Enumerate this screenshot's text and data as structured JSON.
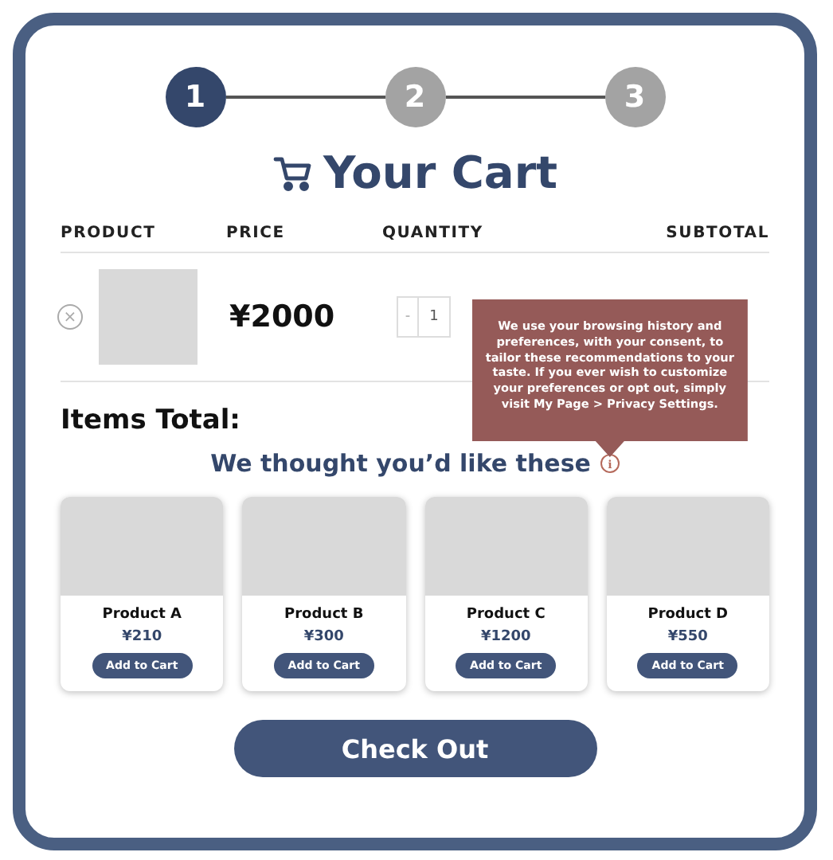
{
  "steps": [
    {
      "label": "1",
      "selected": true
    },
    {
      "label": "2",
      "selected": false
    },
    {
      "label": "3",
      "selected": false
    }
  ],
  "title": "Your Cart",
  "columns": [
    "PRODUCT",
    "PRICE",
    "QUANTITY",
    "SUBTOTAL"
  ],
  "cart_item": {
    "price": "¥2000",
    "quantity": "1",
    "remove": "×",
    "decrement": "-"
  },
  "items_total_label": "Items Total:",
  "recommendations": {
    "heading": "We thought you’d like these",
    "info": "i",
    "tooltip": "We use your browsing history and preferences, with your consent, to tailor these recommendations to your taste. If you ever wish to customize your preferences or opt out, simply visit My Page > Privacy Settings.",
    "products": [
      {
        "name": "Product A",
        "price": "¥210",
        "button": "Add to Cart"
      },
      {
        "name": "Product B",
        "price": "¥300",
        "button": "Add to Cart"
      },
      {
        "name": "Product C",
        "price": "¥1200",
        "button": "Add to Cart"
      },
      {
        "name": "Product D",
        "price": "¥550",
        "button": "Add to Cart"
      }
    ]
  },
  "checkout": "Check Out"
}
